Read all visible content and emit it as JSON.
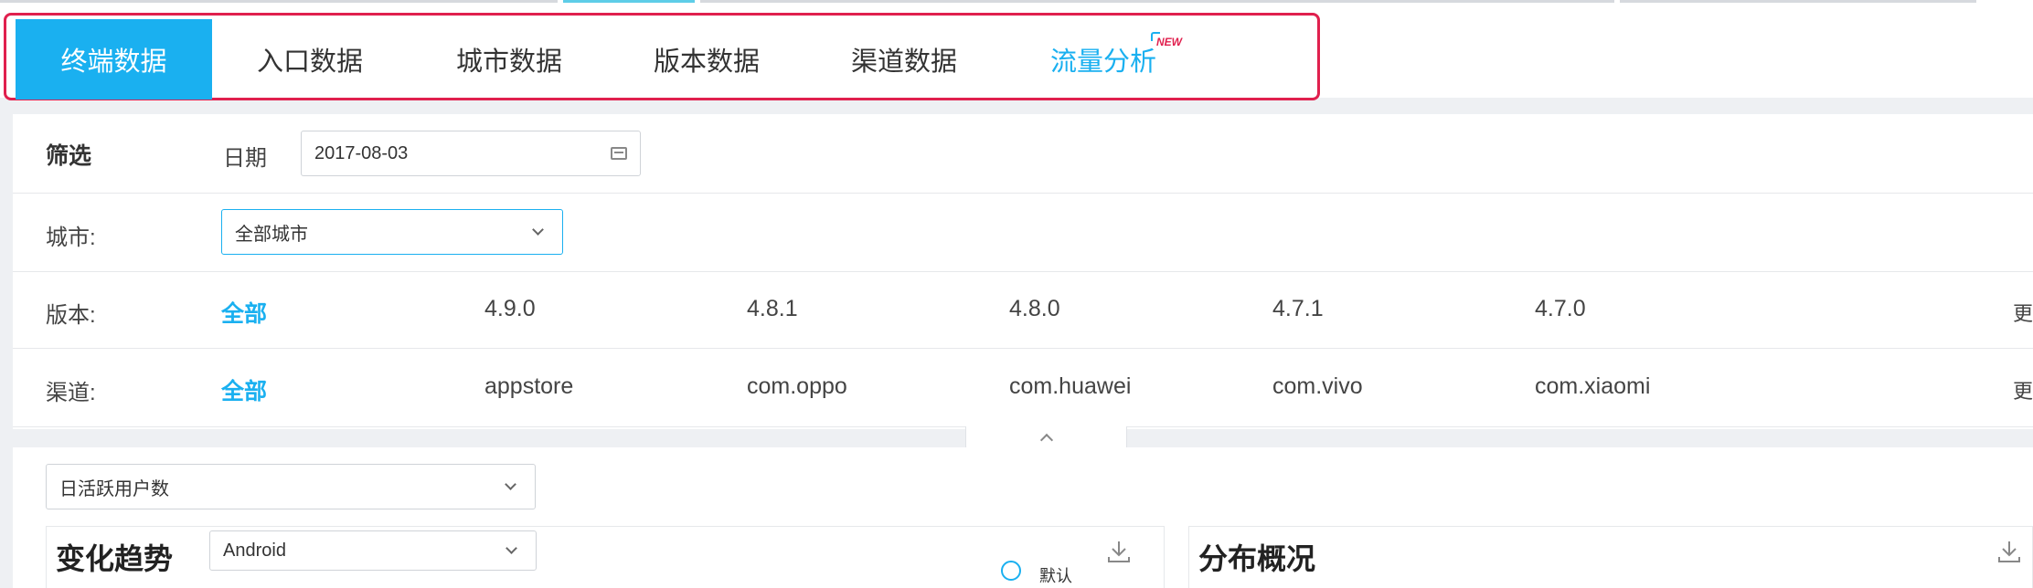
{
  "tabs": [
    {
      "label": "终端数据",
      "active": true
    },
    {
      "label": "入口数据",
      "active": false
    },
    {
      "label": "城市数据",
      "active": false
    },
    {
      "label": "版本数据",
      "active": false
    },
    {
      "label": "渠道数据",
      "active": false
    },
    {
      "label": "流量分析",
      "active": false,
      "highlight": true,
      "badge": "NEW"
    }
  ],
  "filter": {
    "title": "筛选",
    "date_label": "日期",
    "date_value": "2017-08-03",
    "city_label": "城市:",
    "city_value": "全部城市",
    "version_label": "版本:",
    "versions": [
      "全部",
      "4.9.0",
      "4.8.1",
      "4.8.0",
      "4.7.1",
      "4.7.0"
    ],
    "channel_label": "渠道:",
    "channels": [
      "全部",
      "appstore",
      "com.oppo",
      "com.huawei",
      "com.vivo",
      "com.xiaomi"
    ],
    "more_label": "更"
  },
  "metric_select": {
    "value": "日活跃用户数"
  },
  "trend": {
    "title": "变化趋势",
    "platform": "Android",
    "radio_label": "默认"
  },
  "distribution": {
    "title": "分布概况"
  },
  "colors": {
    "accent": "#1ab0f0",
    "frame": "#e0204e"
  },
  "icons": [
    "calendar-icon",
    "chevron-down-icon",
    "chevron-up-icon",
    "download-icon",
    "radio-icon"
  ]
}
